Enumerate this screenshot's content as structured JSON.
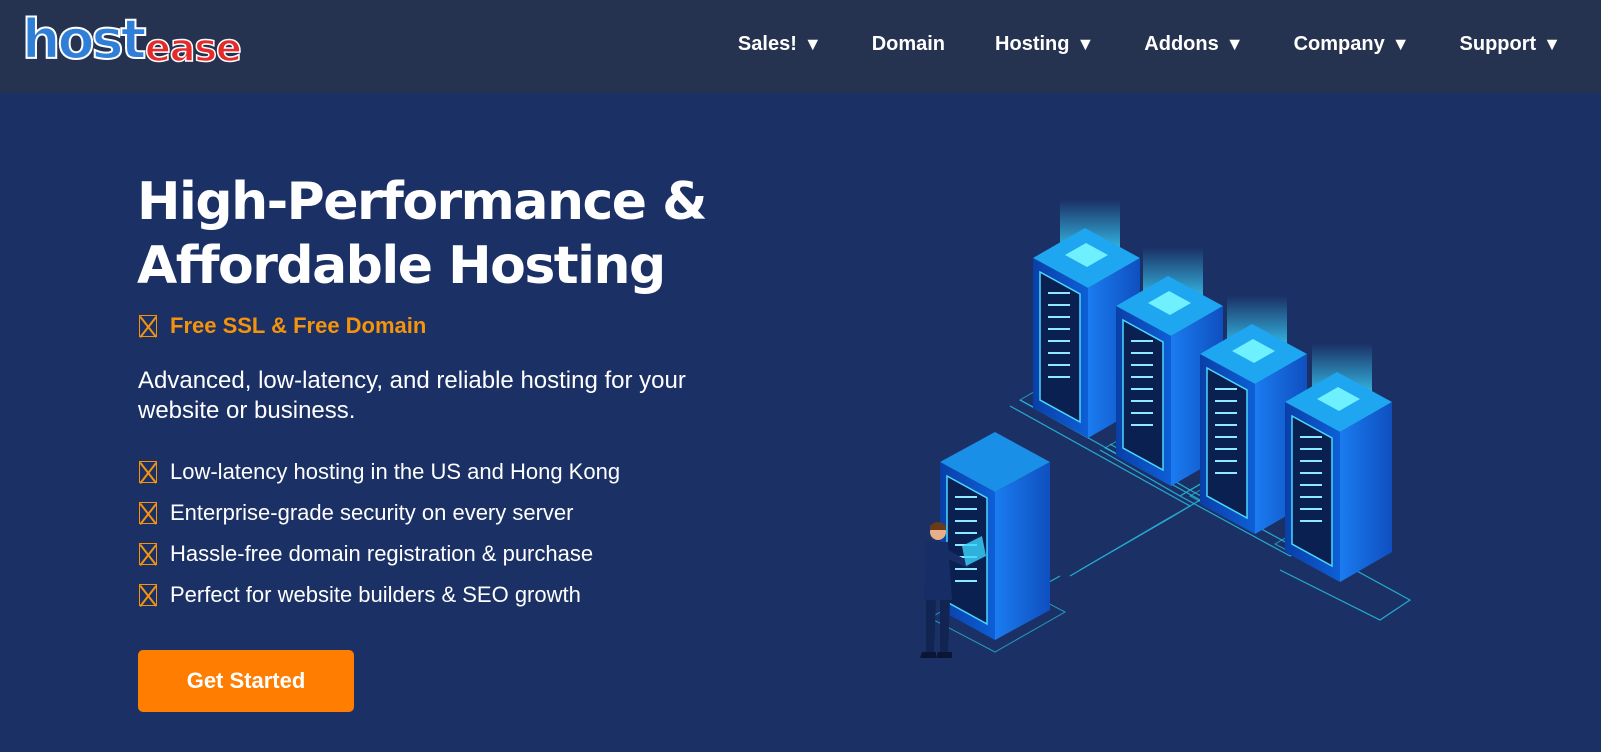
{
  "header": {
    "logo": {
      "part1": "host",
      "part2": "ease"
    },
    "nav": [
      {
        "label": "Sales!",
        "has_dropdown": true
      },
      {
        "label": "Domain",
        "has_dropdown": false
      },
      {
        "label": "Hosting",
        "has_dropdown": true
      },
      {
        "label": "Addons",
        "has_dropdown": true
      },
      {
        "label": "Company",
        "has_dropdown": true
      },
      {
        "label": "Support",
        "has_dropdown": true
      }
    ],
    "caret": "▼"
  },
  "hero": {
    "title_line1": "High-Performance &",
    "title_line2": "Affordable Hosting",
    "tagline": "Free SSL & Free Domain",
    "description": "Advanced, low-latency, and reliable hosting for your website or business.",
    "features": [
      "Low-latency hosting in the US and Hong Kong",
      "Enterprise-grade security on every server",
      "Hassle-free domain registration & purchase",
      "Perfect for website builders & SEO growth"
    ],
    "cta_label": "Get Started",
    "illustration_icon": "server-racks-illustration"
  },
  "colors": {
    "header_bg": "#263350",
    "page_bg": "#1b3166",
    "accent_orange": "#ff7d00",
    "tagline_orange": "#f5930c",
    "logo_blue": "#2f7fd8",
    "logo_red": "#e52a2a"
  }
}
